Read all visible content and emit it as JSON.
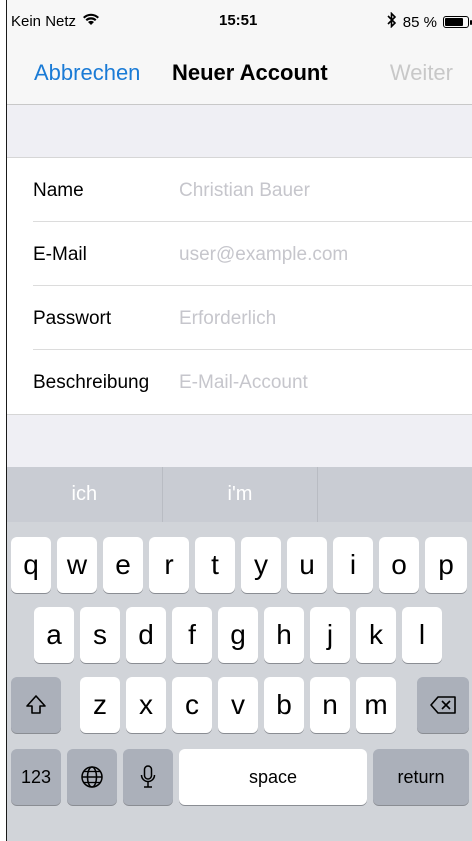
{
  "status": {
    "carrier": "Kein Netz",
    "time": "15:51",
    "battery": "85 %",
    "battery_level": 0.85
  },
  "nav": {
    "cancel": "Abbrechen",
    "title": "Neuer Account",
    "next": "Weiter"
  },
  "form": {
    "rows": [
      {
        "label": "Name",
        "placeholder": "Christian Bauer"
      },
      {
        "label": "E-Mail",
        "placeholder": "user@example.com"
      },
      {
        "label": "Passwort",
        "placeholder": "Erforderlich"
      },
      {
        "label": "Beschreibung",
        "placeholder": "E-Mail-Account"
      }
    ]
  },
  "keyboard": {
    "suggestions": [
      "ich",
      "i'm",
      ""
    ],
    "row1": [
      "q",
      "w",
      "e",
      "r",
      "t",
      "y",
      "u",
      "i",
      "o",
      "p"
    ],
    "row2": [
      "a",
      "s",
      "d",
      "f",
      "g",
      "h",
      "j",
      "k",
      "l"
    ],
    "row3": [
      "z",
      "x",
      "c",
      "v",
      "b",
      "n",
      "m"
    ],
    "numbers_key": "123",
    "space_key": "space",
    "return_key": "return"
  }
}
